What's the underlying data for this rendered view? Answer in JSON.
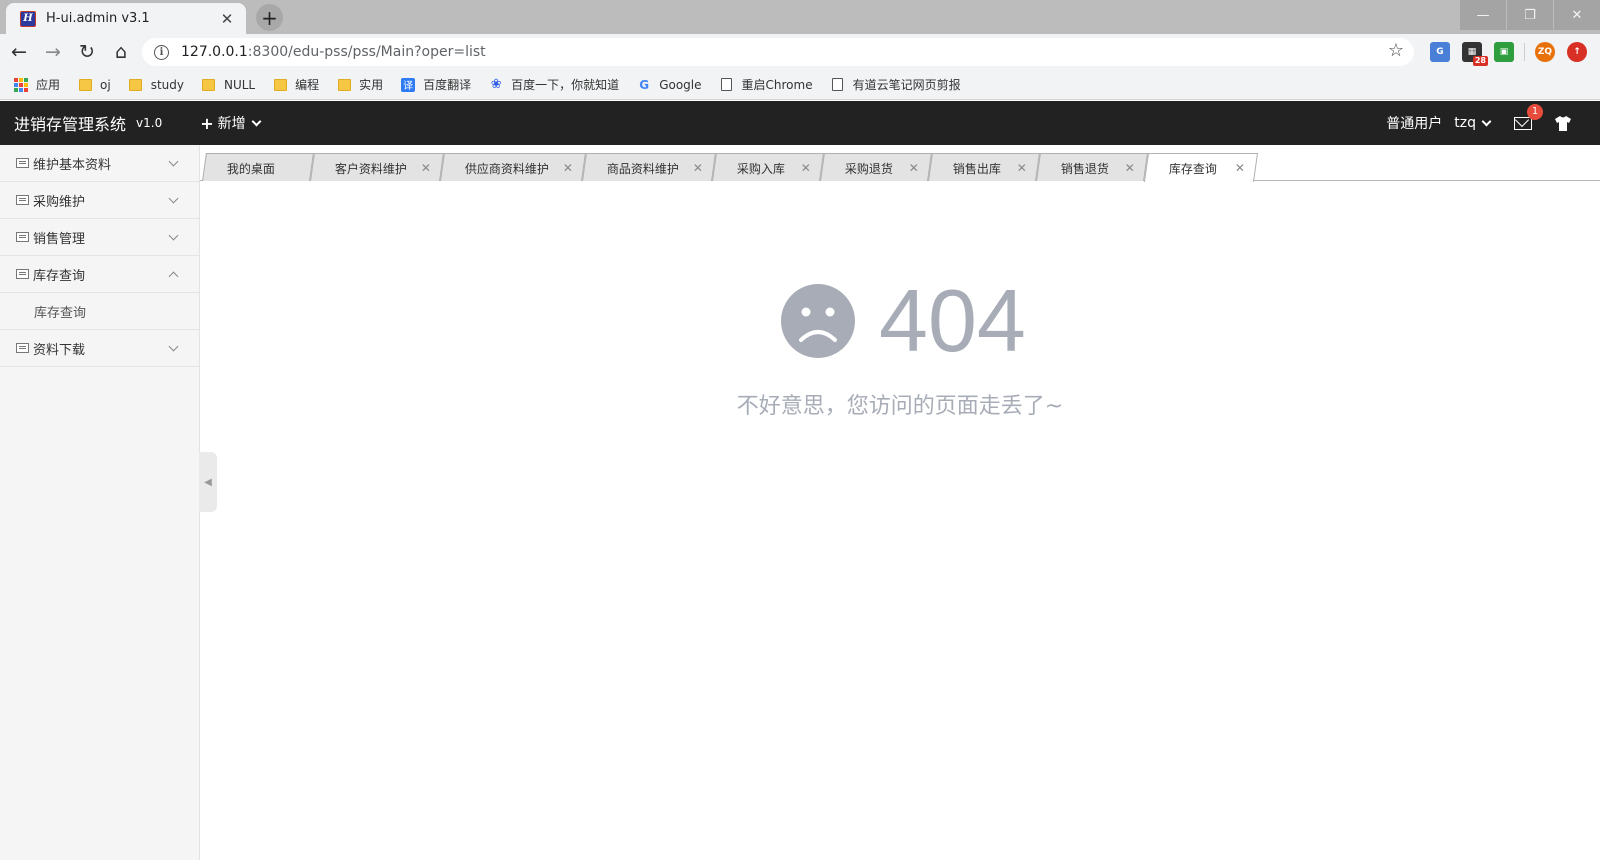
{
  "browser": {
    "tab_title": "H-ui.admin v3.1",
    "favicon_letter": "H",
    "url_host": "127.0.0.1",
    "url_rest": ":8300/edu-pss/pss/Main?oper=list",
    "ext_badge": "28",
    "ext_zq": "ZQ",
    "bookmarks": [
      {
        "label": "应用",
        "icon": "apps-grid-icon"
      },
      {
        "label": "oj",
        "icon": "folder-icon"
      },
      {
        "label": "study",
        "icon": "folder-icon"
      },
      {
        "label": "NULL",
        "icon": "folder-icon"
      },
      {
        "label": "编程",
        "icon": "folder-icon"
      },
      {
        "label": "实用",
        "icon": "folder-icon"
      },
      {
        "label": "百度翻译",
        "icon": "translate-icon"
      },
      {
        "label": "百度一下，你就知道",
        "icon": "baidu-icon"
      },
      {
        "label": "Google",
        "icon": "google-icon"
      },
      {
        "label": "重启Chrome",
        "icon": "page-icon"
      },
      {
        "label": "有道云笔记网页剪报",
        "icon": "page-icon"
      }
    ]
  },
  "header": {
    "logo": "进销存管理系统",
    "version": "v1.0",
    "add_label": "新增",
    "user_role": "普通用户",
    "user_name": "tzq",
    "msg_count": "1"
  },
  "sidebar": {
    "items": [
      {
        "label": "维护基本资料",
        "expanded": false
      },
      {
        "label": "采购维护",
        "expanded": false
      },
      {
        "label": "销售管理",
        "expanded": false
      },
      {
        "label": "库存查询",
        "expanded": true,
        "children": [
          "库存查询"
        ]
      },
      {
        "label": "资料下载",
        "expanded": false
      }
    ]
  },
  "tabs": [
    {
      "label": "我的桌面",
      "closable": false
    },
    {
      "label": "客户资料维护",
      "closable": true
    },
    {
      "label": "供应商资料维护",
      "closable": true
    },
    {
      "label": "商品资料维护",
      "closable": true
    },
    {
      "label": "采购入库",
      "closable": true
    },
    {
      "label": "采购退货",
      "closable": true
    },
    {
      "label": "销售出库",
      "closable": true
    },
    {
      "label": "销售退货",
      "closable": true
    },
    {
      "label": "库存查询",
      "closable": true,
      "active": true
    }
  ],
  "error": {
    "code": "404",
    "message": "不好意思，您访问的页面走丢了~"
  },
  "colors": {
    "header_bg": "#222222",
    "error_gray": "#a7acb7",
    "badge_red": "#e74c3c"
  }
}
